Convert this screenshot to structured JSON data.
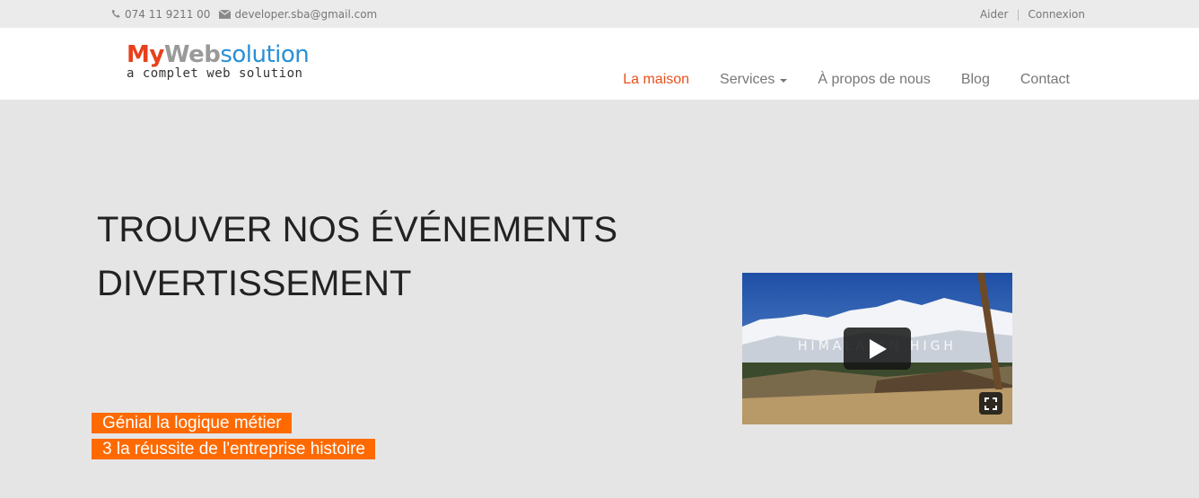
{
  "topbar": {
    "phone": "074 11 9211 00",
    "email": "developer.sba@gmail.com",
    "help": "Aider",
    "separator": "|",
    "login": "Connexion"
  },
  "logo": {
    "my": "My",
    "web": "Web",
    "solution": "solution",
    "tagline": "a complet web solution"
  },
  "nav": {
    "home": "La maison",
    "services": "Services",
    "about": "À propos de nous",
    "blog": "Blog",
    "contact": "Contact"
  },
  "hero": {
    "title_line1": "TROUVER NOS ÉVÉNEMENTS",
    "title_line2": "DIVERTISSEMENT",
    "tag1": "Génial la logique métier",
    "tag2": "3 la réussite de l'entreprise histoire"
  },
  "video": {
    "overlay_title": "HIMALAYAN HIGH"
  },
  "colors": {
    "accent": "#ff6a00",
    "active_nav": "#e8501c",
    "brand_red": "#e8401c",
    "brand_blue": "#2a8fd6"
  }
}
